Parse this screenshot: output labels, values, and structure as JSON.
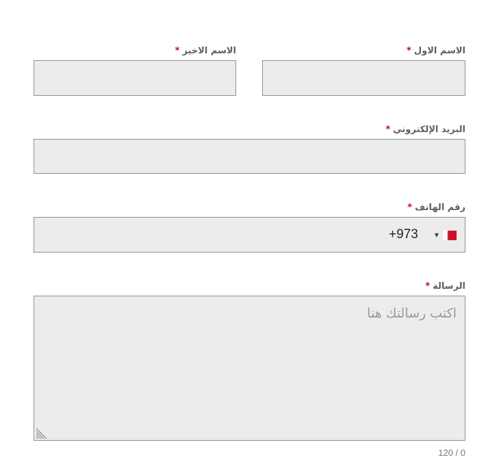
{
  "form": {
    "first_name": {
      "label": "الاسم الاول",
      "required_mark": "*",
      "value": ""
    },
    "last_name": {
      "label": "الاسم الاخير",
      "required_mark": "*",
      "value": ""
    },
    "email": {
      "label": "البريد الإلكتروني",
      "required_mark": "*",
      "value": ""
    },
    "phone": {
      "label": "رقم الهاتف",
      "required_mark": "*",
      "country_code": "+973",
      "flag_icon": "bahrain-flag-icon",
      "caret_icon": "caret-down-icon"
    },
    "message": {
      "label": "الرسالة",
      "required_mark": "*",
      "placeholder": "اكتب رسالتك هنا",
      "char_counter": "120 / 0"
    }
  },
  "colors": {
    "field_background": "#ececec",
    "field_border": "#8f8f8f",
    "required": "#d0021b",
    "label": "#5f5f5f",
    "flag_red": "#ce1126"
  }
}
